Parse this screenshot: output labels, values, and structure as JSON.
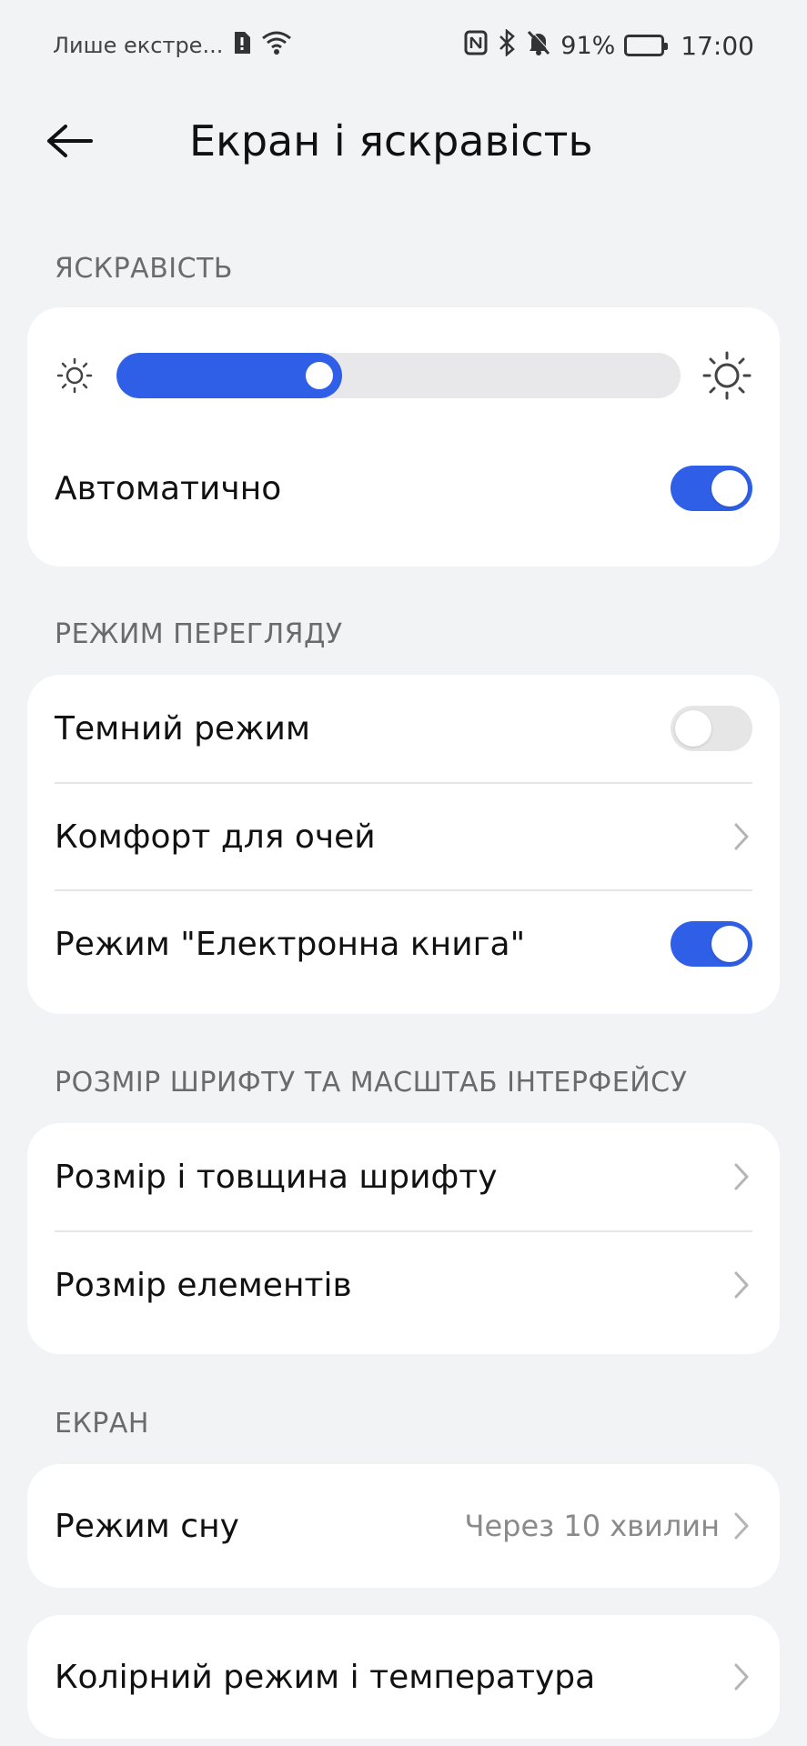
{
  "status_bar": {
    "carrier": "Лише екстре...",
    "battery_percent": "91%",
    "battery_level": 0.91,
    "time": "17:00",
    "icons": [
      "sim-alert-icon",
      "wifi-icon",
      "nfc-icon",
      "bluetooth-icon",
      "mute-bell-icon",
      "battery-icon"
    ]
  },
  "header": {
    "title": "Екран і яскравість"
  },
  "sections": {
    "brightness": {
      "label": "ЯСКРАВІСТЬ",
      "level": 0.4,
      "auto_label": "Автоматично",
      "auto_on": true
    },
    "view_mode": {
      "label": "РЕЖИМ ПЕРЕГЛЯДУ",
      "dark_mode_label": "Темний режим",
      "dark_mode_on": false,
      "eye_comfort_label": "Комфорт для очей",
      "ebook_label": "Режим \"Електронна книга\"",
      "ebook_on": true
    },
    "font_scale": {
      "label": "РОЗМІР ШРИФТУ ТА МАСШТАБ ІНТЕРФЕЙСУ",
      "font_size_label": "Розмір і товщина шрифту",
      "element_size_label": "Розмір елементів"
    },
    "screen": {
      "label": "ЕКРАН",
      "sleep_label": "Режим сну",
      "sleep_value": "Через 10 хвилин",
      "color_mode_label": "Колірний режим і температура"
    }
  },
  "colors": {
    "accent": "#2f5fe6",
    "background": "#f2f3f5",
    "card": "#ffffff"
  }
}
